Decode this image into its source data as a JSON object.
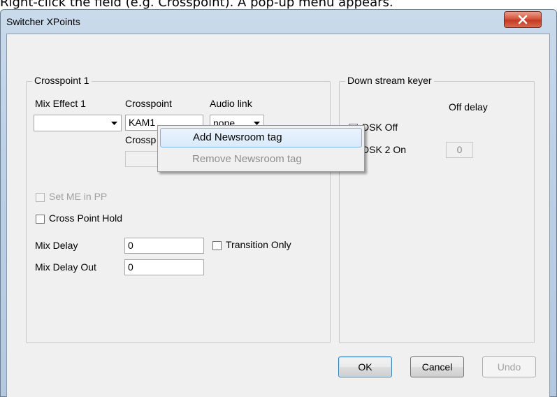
{
  "caption": "Right-click the field (e.g. Crosspoint). A pop-up menu appears.",
  "window": {
    "title": "Switcher XPoints",
    "close_icon": "close-icon"
  },
  "crosspoint_group": {
    "legend": "Crosspoint 1",
    "mix_effect_label": "Mix Effect 1",
    "mix_effect_value": "",
    "crosspoint_label": "Crosspoint",
    "crosspoint_value": "KAM1",
    "audio_link_label": "Audio link",
    "audio_link_value": "none",
    "crosspoint_2_label": "Crossp",
    "crosspoint_2_value": "",
    "set_me_in_pp_label": "Set ME in PP",
    "cross_point_hold_label": "Cross Point Hold",
    "mix_delay_label": "Mix Delay",
    "mix_delay_value": "0",
    "transition_only_label": "Transition Only",
    "mix_delay_out_label": "Mix Delay Out",
    "mix_delay_out_value": "0"
  },
  "dsk_group": {
    "legend": "Down stream keyer",
    "off_delay_label": "Off delay",
    "dsk_off_label": "DSK Off",
    "dsk2_on_label": "DSK 2 On",
    "dsk2_delay_value": "0"
  },
  "context_menu": {
    "items": [
      {
        "label": "Add Newsroom tag",
        "enabled": true,
        "highlighted": true
      },
      {
        "label": "Remove Newsroom tag",
        "enabled": false,
        "highlighted": false
      }
    ]
  },
  "buttons": {
    "ok": "OK",
    "cancel": "Cancel",
    "undo": "Undo"
  }
}
